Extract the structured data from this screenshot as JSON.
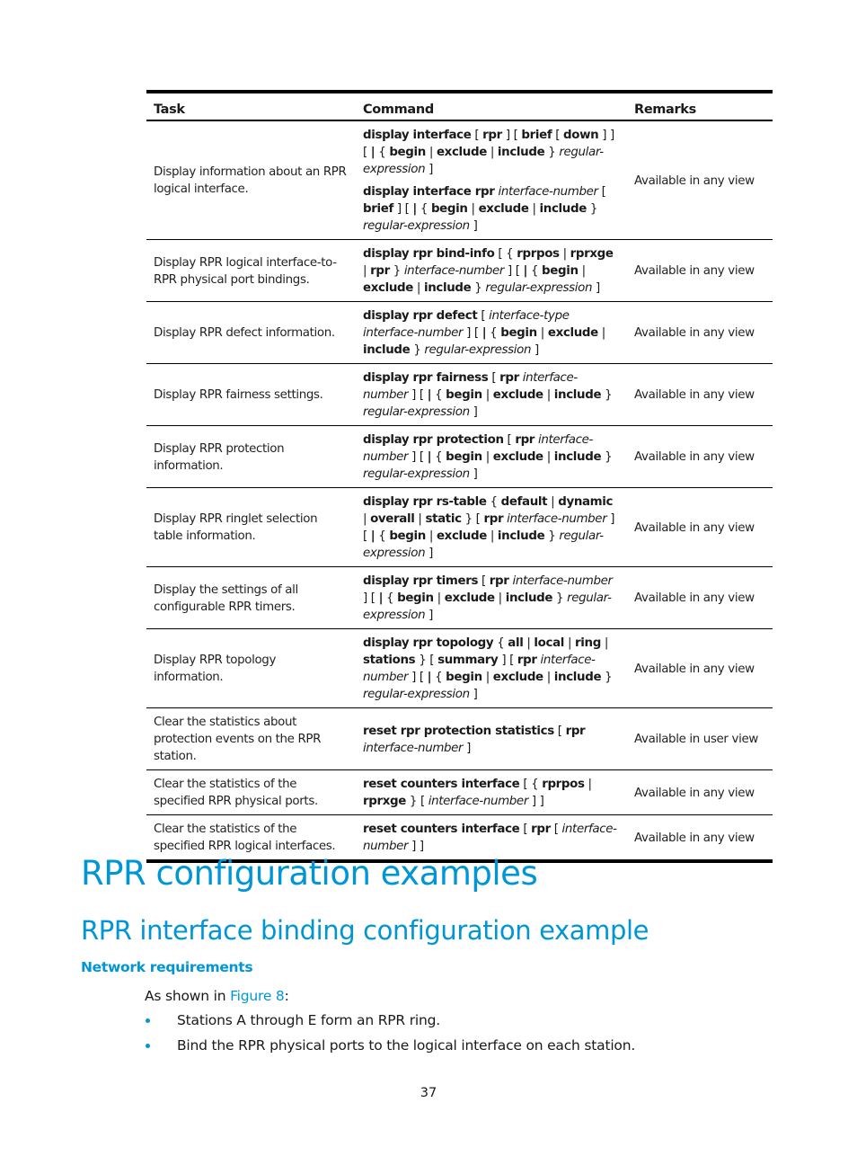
{
  "table": {
    "headers": [
      "Task",
      "Command",
      "Remarks"
    ],
    "rows": [
      {
        "task": "Display information about an RPR logical interface.",
        "commands": [
          [
            [
              "b",
              "display interface"
            ],
            [
              "n",
              " [ "
            ],
            [
              "b",
              "rpr"
            ],
            [
              "n",
              " ] [ "
            ],
            [
              "b",
              "brief"
            ],
            [
              "n",
              " [ "
            ],
            [
              "b",
              "down"
            ],
            [
              "n",
              " ] ] [ "
            ],
            [
              "b",
              "|"
            ],
            [
              "n",
              " { "
            ],
            [
              "b",
              "begin"
            ],
            [
              "n",
              " | "
            ],
            [
              "b",
              "exclude"
            ],
            [
              "n",
              " | "
            ],
            [
              "b",
              "include"
            ],
            [
              "n",
              " } "
            ],
            [
              "i",
              "regular-expression"
            ],
            [
              "n",
              " ]"
            ]
          ],
          [
            [
              "b",
              "display interface rpr"
            ],
            [
              "n",
              " "
            ],
            [
              "i",
              "interface-number"
            ],
            [
              "n",
              " [ "
            ],
            [
              "b",
              "brief"
            ],
            [
              "n",
              " ] [ "
            ],
            [
              "b",
              "|"
            ],
            [
              "n",
              " { "
            ],
            [
              "b",
              "begin"
            ],
            [
              "n",
              " | "
            ],
            [
              "b",
              "exclude"
            ],
            [
              "n",
              " | "
            ],
            [
              "b",
              "include"
            ],
            [
              "n",
              " } "
            ],
            [
              "i",
              "regular-expression"
            ],
            [
              "n",
              " ]"
            ]
          ]
        ],
        "remark": "Available in any view"
      },
      {
        "task": "Display RPR logical interface-to-RPR physical port bindings.",
        "commands": [
          [
            [
              "b",
              "display rpr bind-info"
            ],
            [
              "n",
              " [ { "
            ],
            [
              "b",
              "rprpos"
            ],
            [
              "n",
              " | "
            ],
            [
              "b",
              "rprxge"
            ],
            [
              "n",
              " | "
            ],
            [
              "b",
              "rpr"
            ],
            [
              "n",
              " } "
            ],
            [
              "i",
              "interface-number"
            ],
            [
              "n",
              " ] [ "
            ],
            [
              "b",
              "|"
            ],
            [
              "n",
              " { "
            ],
            [
              "b",
              "begin"
            ],
            [
              "n",
              " | "
            ],
            [
              "b",
              "exclude"
            ],
            [
              "n",
              " | "
            ],
            [
              "b",
              "include"
            ],
            [
              "n",
              " } "
            ],
            [
              "i",
              "regular-expression"
            ],
            [
              "n",
              " ]"
            ]
          ]
        ],
        "remark": "Available in any view"
      },
      {
        "task": "Display RPR defect information.",
        "commands": [
          [
            [
              "b",
              "display rpr defect"
            ],
            [
              "n",
              " [ "
            ],
            [
              "i",
              "interface-type interface-number"
            ],
            [
              "n",
              " ] [ "
            ],
            [
              "b",
              "|"
            ],
            [
              "n",
              " { "
            ],
            [
              "b",
              "begin"
            ],
            [
              "n",
              " | "
            ],
            [
              "b",
              "exclude"
            ],
            [
              "n",
              " | "
            ],
            [
              "b",
              "include"
            ],
            [
              "n",
              " } "
            ],
            [
              "i",
              "regular-expression"
            ],
            [
              "n",
              " ]"
            ]
          ]
        ],
        "remark": "Available in any view"
      },
      {
        "task": "Display RPR fairness settings.",
        "commands": [
          [
            [
              "b",
              "display rpr fairness"
            ],
            [
              "n",
              " [ "
            ],
            [
              "b",
              "rpr"
            ],
            [
              "n",
              " "
            ],
            [
              "i",
              "interface-number"
            ],
            [
              "n",
              " ] [ "
            ],
            [
              "b",
              "|"
            ],
            [
              "n",
              " { "
            ],
            [
              "b",
              "begin"
            ],
            [
              "n",
              " | "
            ],
            [
              "b",
              "exclude"
            ],
            [
              "n",
              " | "
            ],
            [
              "b",
              "include"
            ],
            [
              "n",
              " } "
            ],
            [
              "i",
              "regular-expression"
            ],
            [
              "n",
              " ]"
            ]
          ]
        ],
        "remark": "Available in any view"
      },
      {
        "task": "Display RPR protection information.",
        "commands": [
          [
            [
              "b",
              "display rpr protection"
            ],
            [
              "n",
              " [ "
            ],
            [
              "b",
              "rpr"
            ],
            [
              "n",
              " "
            ],
            [
              "i",
              "interface-number"
            ],
            [
              "n",
              " ] [ "
            ],
            [
              "b",
              "|"
            ],
            [
              "n",
              " { "
            ],
            [
              "b",
              "begin"
            ],
            [
              "n",
              " | "
            ],
            [
              "b",
              "exclude"
            ],
            [
              "n",
              " | "
            ],
            [
              "b",
              "include"
            ],
            [
              "n",
              " } "
            ],
            [
              "i",
              "regular-expression"
            ],
            [
              "n",
              " ]"
            ]
          ]
        ],
        "remark": "Available in any view"
      },
      {
        "task": "Display RPR ringlet selection table information.",
        "commands": [
          [
            [
              "b",
              "display rpr rs-table"
            ],
            [
              "n",
              " { "
            ],
            [
              "b",
              "default"
            ],
            [
              "n",
              " | "
            ],
            [
              "b",
              "dynamic"
            ],
            [
              "n",
              " | "
            ],
            [
              "b",
              "overall"
            ],
            [
              "n",
              " | "
            ],
            [
              "b",
              "static"
            ],
            [
              "n",
              " } [ "
            ],
            [
              "b",
              "rpr"
            ],
            [
              "n",
              " "
            ],
            [
              "i",
              "interface-number"
            ],
            [
              "n",
              " ] [ "
            ],
            [
              "b",
              "|"
            ],
            [
              "n",
              " { "
            ],
            [
              "b",
              "begin"
            ],
            [
              "n",
              " | "
            ],
            [
              "b",
              "exclude"
            ],
            [
              "n",
              " | "
            ],
            [
              "b",
              "include"
            ],
            [
              "n",
              " } "
            ],
            [
              "i",
              "regular-expression"
            ],
            [
              "n",
              " ]"
            ]
          ]
        ],
        "remark": "Available in any view"
      },
      {
        "task": "Display the settings of all configurable RPR timers.",
        "commands": [
          [
            [
              "b",
              "display rpr timers"
            ],
            [
              "n",
              " [ "
            ],
            [
              "b",
              "rpr"
            ],
            [
              "n",
              " "
            ],
            [
              "i",
              "interface-number"
            ],
            [
              "n",
              " ] [ "
            ],
            [
              "b",
              "|"
            ],
            [
              "n",
              " { "
            ],
            [
              "b",
              "begin"
            ],
            [
              "n",
              " | "
            ],
            [
              "b",
              "exclude"
            ],
            [
              "n",
              " | "
            ],
            [
              "b",
              "include"
            ],
            [
              "n",
              " } "
            ],
            [
              "i",
              "regular-expression"
            ],
            [
              "n",
              " ]"
            ]
          ]
        ],
        "remark": "Available in any view"
      },
      {
        "task": "Display RPR topology information.",
        "commands": [
          [
            [
              "b",
              "display rpr topology"
            ],
            [
              "n",
              " { "
            ],
            [
              "b",
              "all"
            ],
            [
              "n",
              " | "
            ],
            [
              "b",
              "local"
            ],
            [
              "n",
              " | "
            ],
            [
              "b",
              "ring"
            ],
            [
              "n",
              " | "
            ],
            [
              "b",
              "stations"
            ],
            [
              "n",
              " } [ "
            ],
            [
              "b",
              "summary"
            ],
            [
              "n",
              " ] [ "
            ],
            [
              "b",
              "rpr"
            ],
            [
              "n",
              " "
            ],
            [
              "i",
              "interface-number"
            ],
            [
              "n",
              " ] [ "
            ],
            [
              "b",
              "|"
            ],
            [
              "n",
              " { "
            ],
            [
              "b",
              "begin"
            ],
            [
              "n",
              " | "
            ],
            [
              "b",
              "exclude"
            ],
            [
              "n",
              " | "
            ],
            [
              "b",
              "include"
            ],
            [
              "n",
              " } "
            ],
            [
              "i",
              "regular-expression"
            ],
            [
              "n",
              " ]"
            ]
          ]
        ],
        "remark": "Available in any view"
      },
      {
        "task": "Clear the statistics about protection events on the RPR station.",
        "commands": [
          [
            [
              "b",
              "reset rpr protection statistics"
            ],
            [
              "n",
              " [ "
            ],
            [
              "b",
              "rpr"
            ],
            [
              "n",
              " "
            ],
            [
              "i",
              "interface-number"
            ],
            [
              "n",
              " ]"
            ]
          ]
        ],
        "remark": "Available in user view"
      },
      {
        "task": "Clear the statistics of the specified RPR physical ports.",
        "commands": [
          [
            [
              "b",
              "reset counters interface"
            ],
            [
              "n",
              " [ { "
            ],
            [
              "b",
              "rprpos"
            ],
            [
              "n",
              " | "
            ],
            [
              "b",
              "rprxge"
            ],
            [
              "n",
              " } [ "
            ],
            [
              "i",
              "interface-number"
            ],
            [
              "n",
              " ] ]"
            ]
          ]
        ],
        "remark": "Available in any view"
      },
      {
        "task": "Clear the statistics of the specified RPR logical interfaces.",
        "commands": [
          [
            [
              "b",
              "reset counters interface"
            ],
            [
              "n",
              " [ "
            ],
            [
              "b",
              "rpr"
            ],
            [
              "n",
              " [ "
            ],
            [
              "i",
              "interface-number"
            ],
            [
              "n",
              " ] ]"
            ]
          ]
        ],
        "remark": "Available in any view"
      }
    ]
  },
  "section": {
    "title": "RPR configuration examples",
    "subtitle": "RPR interface binding configuration example",
    "requirements_heading": "Network requirements",
    "intro_prefix": "As shown in ",
    "intro_link": "Figure 8",
    "intro_suffix": ":",
    "bullets": [
      "Stations A through E form an RPR ring.",
      "Bind the RPR physical ports to the logical interface on each station."
    ]
  },
  "page_number": "37",
  "colors": {
    "accent": "#0096d6",
    "text": "#1a1a1a",
    "rule": "#000000"
  }
}
